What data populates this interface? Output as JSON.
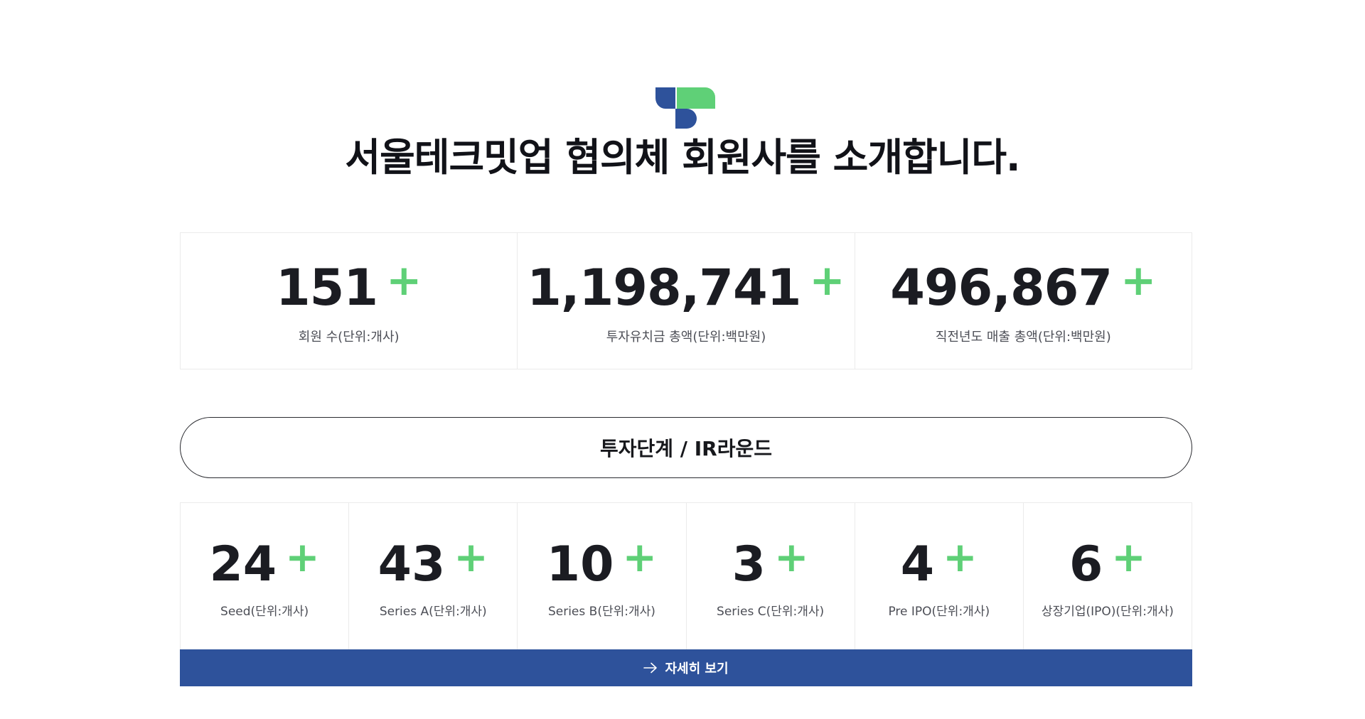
{
  "header": {
    "title": "서울테크밋업 협의체 회원사를 소개합니다.",
    "logo_colors": {
      "blue": "#2e529b",
      "green": "#5fd077"
    }
  },
  "stats": [
    {
      "value": "151",
      "plus": "+",
      "label": "회원 수(단위:개사)"
    },
    {
      "value": "1,198,741",
      "plus": "+",
      "label": "투자유치금 총액(단위:백만원)"
    },
    {
      "value": "496,867",
      "plus": "+",
      "label": "직전년도 매출 총액(단위:백만원)"
    }
  ],
  "stage_section": {
    "title": "투자단계 / IR라운드",
    "items": [
      {
        "value": "24",
        "plus": "+",
        "label": "Seed(단위:개사)"
      },
      {
        "value": "43",
        "plus": "+",
        "label": "Series A(단위:개사)"
      },
      {
        "value": "10",
        "plus": "+",
        "label": "Series B(단위:개사)"
      },
      {
        "value": "3",
        "plus": "+",
        "label": "Series C(단위:개사)"
      },
      {
        "value": "4",
        "plus": "+",
        "label": "Pre IPO(단위:개사)"
      },
      {
        "value": "6",
        "plus": "+",
        "label": "상장기업(IPO)(단위:개사)"
      }
    ]
  },
  "detail_button": {
    "label": "자세히 보기",
    "icon": "arrow-right-icon"
  },
  "colors": {
    "accent_green": "#5fd077",
    "button_blue": "#2e529b",
    "text_dark": "#1b1c22"
  }
}
